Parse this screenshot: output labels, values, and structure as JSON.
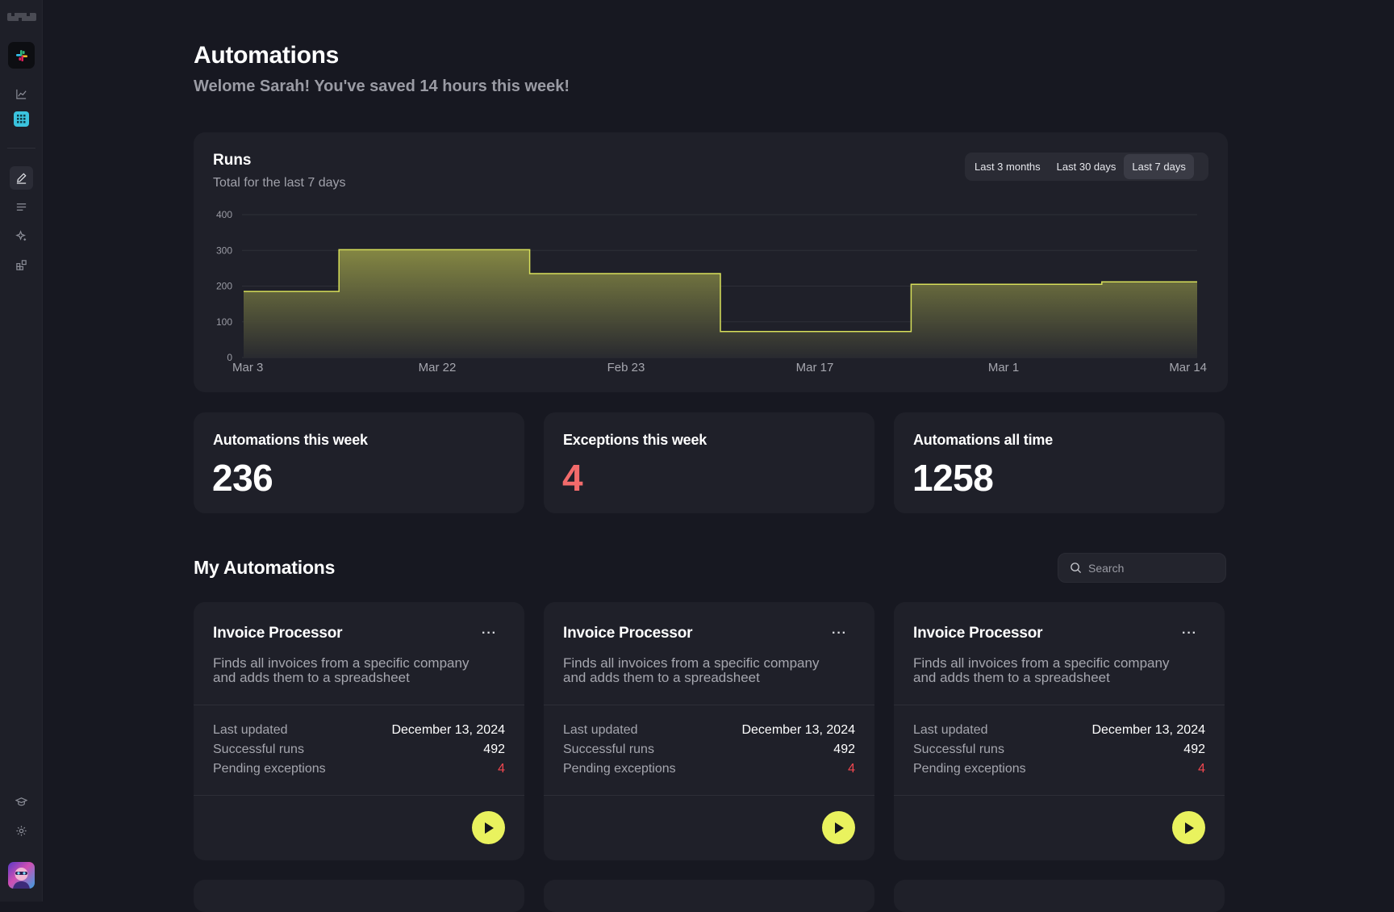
{
  "page": {
    "title": "Automations",
    "subtitle": "Welome Sarah! You've saved 14 hours this week!"
  },
  "sidebar": {
    "items": [
      "analytics-icon",
      "apps-grid-icon",
      "pen-icon",
      "list-icon",
      "sparkle-icon",
      "integrations-icon"
    ],
    "bottom": [
      "learn-icon",
      "settings-icon"
    ]
  },
  "runs": {
    "title": "Runs",
    "subtitle": "Total for the last 7 days",
    "ranges": [
      "Last 3 months",
      "Last 30 days",
      "Last 7 days"
    ],
    "active_range": "Last 7 days"
  },
  "chart_data": {
    "type": "area",
    "step": true,
    "y_ticks": [
      "0",
      "100",
      "200",
      "300",
      "400"
    ],
    "ylim": [
      0,
      400
    ],
    "x_labels": [
      "Mar 3",
      "Mar 22",
      "Feb 23",
      "Mar 17",
      "Mar 1",
      "Mar 14"
    ],
    "steps": [
      {
        "from": 0.0,
        "to": 0.1,
        "value": 185
      },
      {
        "from": 0.1,
        "to": 0.3,
        "value": 302
      },
      {
        "from": 0.3,
        "to": 0.5,
        "value": 235
      },
      {
        "from": 0.5,
        "to": 0.7,
        "value": 73
      },
      {
        "from": 0.7,
        "to": 0.9,
        "value": 205
      },
      {
        "from": 0.9,
        "to": 1.0,
        "value": 212
      }
    ],
    "line_color": "#d8e05a"
  },
  "stats": [
    {
      "label": "Automations this week",
      "value": "236",
      "color": "#ffffff"
    },
    {
      "label": "Exceptions this week",
      "value": "4",
      "color": "#f26b6b"
    },
    {
      "label": "Automations all time",
      "value": "1258",
      "color": "#ffffff"
    }
  ],
  "my_automations": {
    "title": "My Automations",
    "search_placeholder": "Search",
    "cards": [
      {
        "name": "Invoice Processor",
        "description": "Finds all invoices from a specific company and adds them to a spreadsheet",
        "last_updated_label": "Last updated",
        "last_updated": "December 13, 2024",
        "runs_label": "Successful runs",
        "runs": "492",
        "exceptions_label": "Pending exceptions",
        "exceptions": "4",
        "more": "···"
      },
      {
        "name": "Invoice Processor",
        "description": "Finds all invoices from a specific company and adds them to a spreadsheet",
        "last_updated_label": "Last updated",
        "last_updated": "December 13, 2024",
        "runs_label": "Successful runs",
        "runs": "492",
        "exceptions_label": "Pending exceptions",
        "exceptions": "4",
        "more": "···"
      },
      {
        "name": "Invoice Processor",
        "description": "Finds all invoices from a specific company and adds them to a spreadsheet",
        "last_updated_label": "Last updated",
        "last_updated": "December 13, 2024",
        "runs_label": "Successful runs",
        "runs": "492",
        "exceptions_label": "Pending exceptions",
        "exceptions": "4",
        "more": "···"
      }
    ]
  },
  "colors": {
    "accent": "#e9f25e",
    "danger": "#f0474f",
    "background": "#171821",
    "panel": "#1f2029"
  }
}
